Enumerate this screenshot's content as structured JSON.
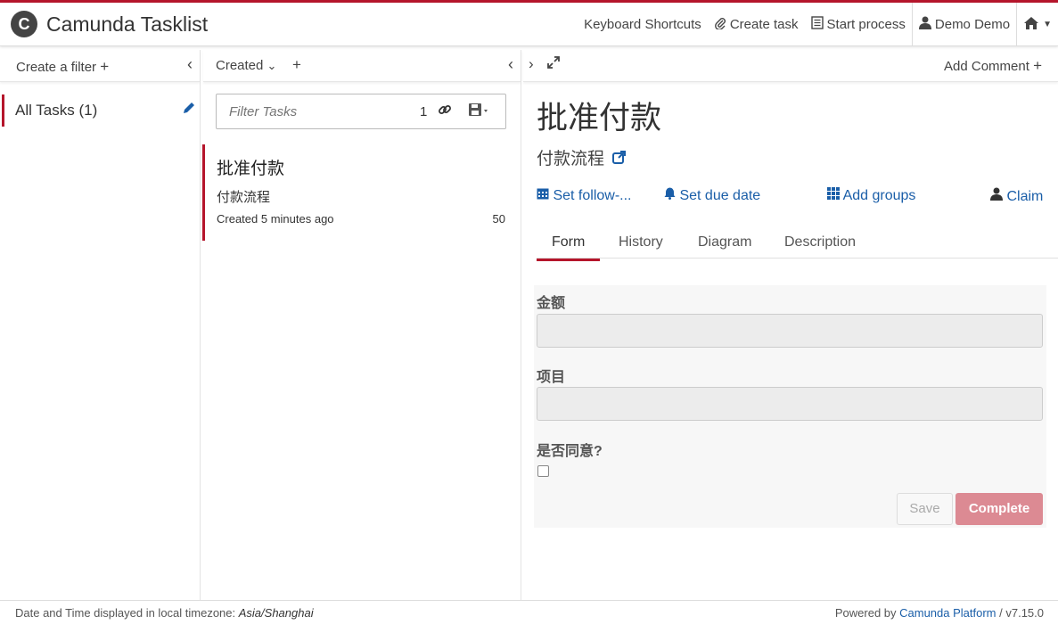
{
  "app": {
    "title": "Camunda Tasklist",
    "logo_letter": "C"
  },
  "topnav": {
    "keyboard_shortcuts": "Keyboard Shortcuts",
    "create_task": "Create task",
    "start_process": "Start process",
    "user": "Demo Demo"
  },
  "filters": {
    "header": "Create a filter",
    "items": [
      {
        "label": "All Tasks (1)"
      }
    ]
  },
  "tasklist": {
    "sort_label": "Created",
    "search_placeholder": "Filter Tasks",
    "count": "1",
    "tasks": [
      {
        "name": "批准付款",
        "process": "付款流程",
        "created": "Created 5 minutes ago",
        "priority": "50"
      }
    ]
  },
  "detail": {
    "add_comment": "Add Comment",
    "title": "批准付款",
    "process": "付款流程",
    "actions": {
      "follow_up": "Set follow-...",
      "due_date": "Set due date",
      "groups": "Add groups",
      "claim": "Claim"
    },
    "tabs": [
      "Form",
      "History",
      "Diagram",
      "Description"
    ],
    "form": {
      "fields": [
        {
          "label": "金额",
          "value": ""
        },
        {
          "label": "项目",
          "value": ""
        }
      ],
      "checkbox_label": "是否同意?",
      "save": "Save",
      "complete": "Complete"
    }
  },
  "footer": {
    "timezone_text": "Date and Time displayed in local timezone: ",
    "timezone": "Asia/Shanghai",
    "powered_by": "Powered by ",
    "brand": "Camunda Platform",
    "version": " / v7.15.0"
  },
  "colors": {
    "accent": "#b5152b",
    "link": "#1a5ea8"
  }
}
